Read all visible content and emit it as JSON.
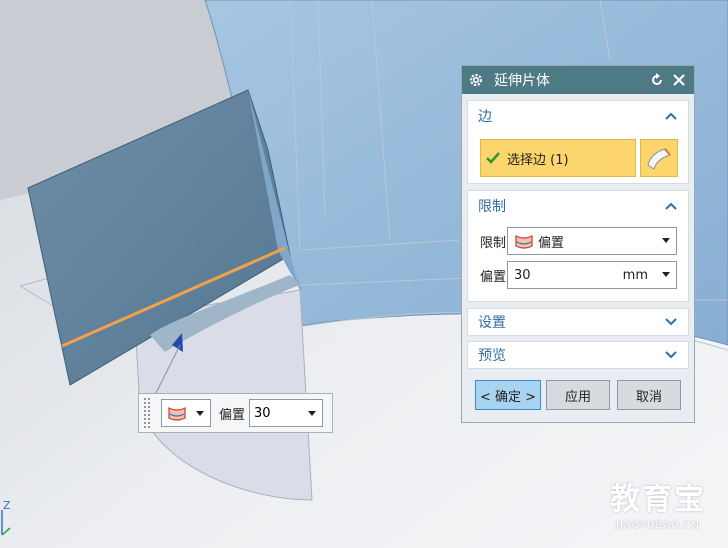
{
  "dialog": {
    "title": "延伸片体",
    "edge_group": {
      "header": "边",
      "select_label": "选择边 (1)"
    },
    "limit_group": {
      "header": "限制",
      "limit_label": "限制",
      "limit_value": "偏置",
      "offset_label": "偏置",
      "offset_value": "30",
      "offset_unit": "mm"
    },
    "settings_group": {
      "header": "设置"
    },
    "preview_group": {
      "header": "预览"
    },
    "buttons": {
      "ok": "< 确定 >",
      "apply": "应用",
      "cancel": "取消"
    }
  },
  "floatbar": {
    "offset_label": "偏置",
    "offset_value": "30"
  },
  "axis": {
    "label": "Z"
  },
  "watermark": {
    "main": "教育宝",
    "sub": "JIAOYUBAO.CN"
  },
  "colors": {
    "title_bar": "#4d7a84",
    "selection": "#fcd66c",
    "edge_highlight": "#f2a14a",
    "group_header": "#2f6fa3"
  }
}
